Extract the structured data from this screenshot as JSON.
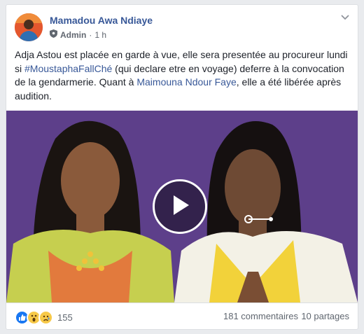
{
  "post": {
    "author": "Mamadou Awa Ndiaye",
    "role_badge": "Admin",
    "separator": "·",
    "time": "1 h",
    "text": {
      "part1": "Adja Astou est placée en garde à vue, elle sera presentée au procureur lundi si ",
      "hashtag": "#MoustaphaFallChé",
      "part2": " (qui declare etre en voyage) deferre à la convocation de la gendarmerie. Quant à ",
      "mention": "Maimouna Ndour Faye",
      "part3": ", elle a été libérée après audition."
    }
  },
  "video": {
    "background_color": "#5d3f8a",
    "play_icon": "play-icon"
  },
  "footer": {
    "reaction_icons": [
      "like-icon",
      "wow-icon",
      "sad-icon"
    ],
    "reaction_count": "155",
    "comments": "181 commentaires",
    "shares": "10 partages"
  },
  "colors": {
    "link": "#385898",
    "like": "#1877f2",
    "reaction_yellow": "#f7c948"
  }
}
